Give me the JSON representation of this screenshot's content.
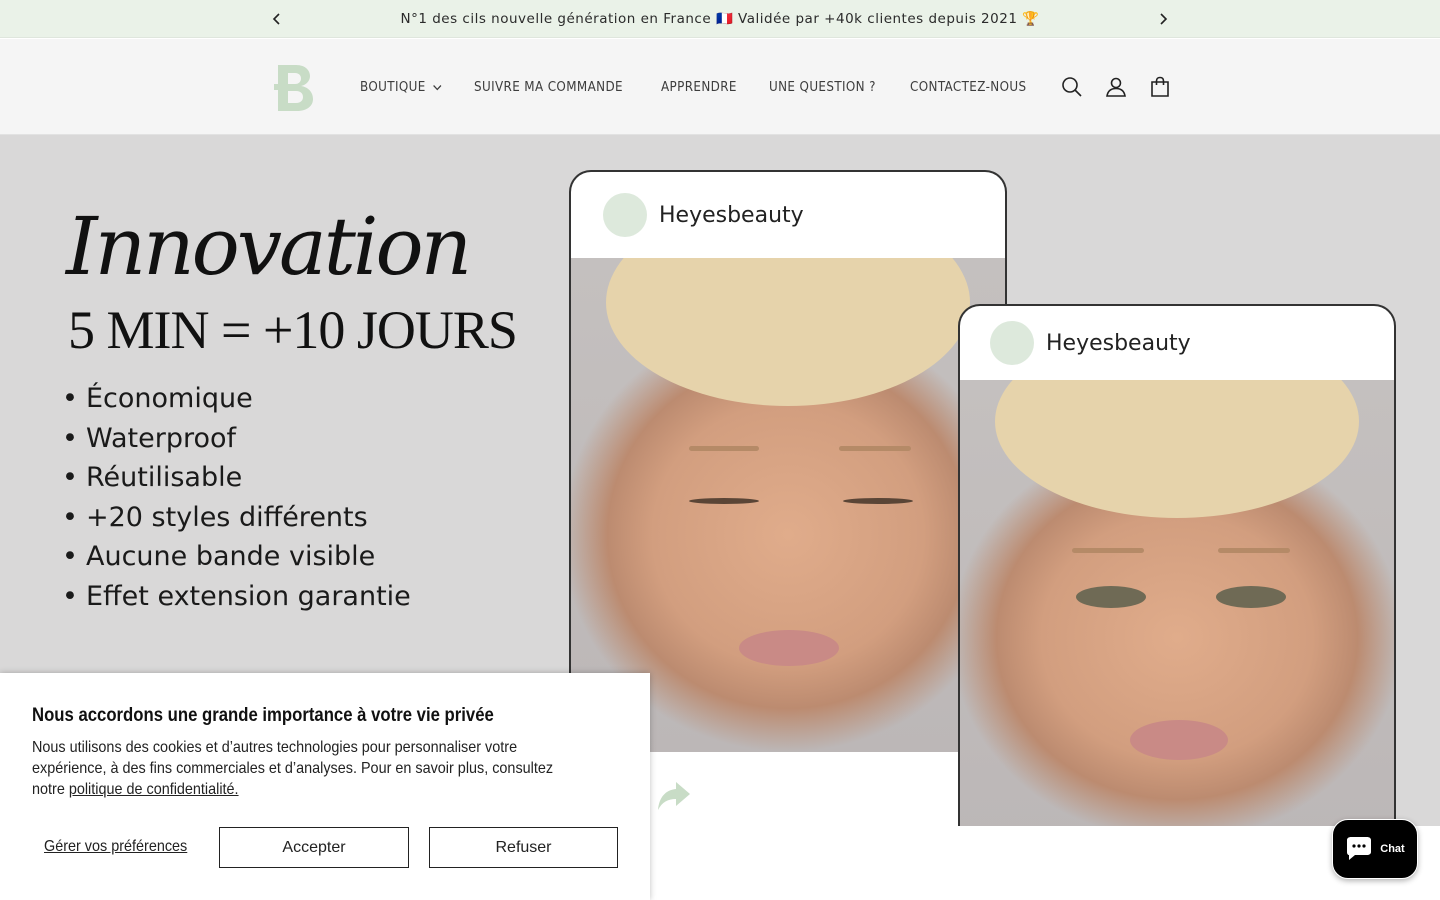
{
  "announcement": {
    "text": "N°1 des cils nouvelle génération en France 🇫🇷 Validée par +40k clientes depuis 2021 🏆"
  },
  "nav": {
    "items": [
      {
        "label": "BOUTIQUE",
        "has_dropdown": true
      },
      {
        "label": "SUIVRE MA COMMANDE"
      },
      {
        "label": "APPRENDRE"
      },
      {
        "label": "UNE QUESTION ?"
      },
      {
        "label": "CONTACTEZ-NOUS"
      }
    ]
  },
  "header_icons": [
    "search-icon",
    "account-icon",
    "cart-icon"
  ],
  "hero": {
    "title": "Innovation",
    "subtitle": "5 MIN = +10 JOURS",
    "features": [
      "Économique",
      "Waterproof",
      "Réutilisable",
      "+20 styles différents",
      "Aucune bande visible",
      "Effet extension garantie"
    ],
    "cards": [
      {
        "name": "Heyesbeauty"
      },
      {
        "name": "Heyesbeauty"
      }
    ]
  },
  "cookie_banner": {
    "title": "Nous accordons une grande importance à votre vie privée",
    "body": "Nous utilisons des cookies et d’autres technologies pour personnaliser votre expérience, à des fins commerciales et d’analyses. Pour en savoir plus, consultez notre",
    "link": "politique de confidentialité.",
    "preferences_label": "Gérer vos préférences",
    "accept_label": "Accepter",
    "refuse_label": "Refuser"
  },
  "chat": {
    "label": "Chat"
  },
  "colors": {
    "announcement_bg": "#eaf2e8",
    "header_bg": "#f5f5f5",
    "hero_bg": "#d9d8d8",
    "brand_green": "#c8dcc6",
    "chat_bg": "#000000"
  }
}
